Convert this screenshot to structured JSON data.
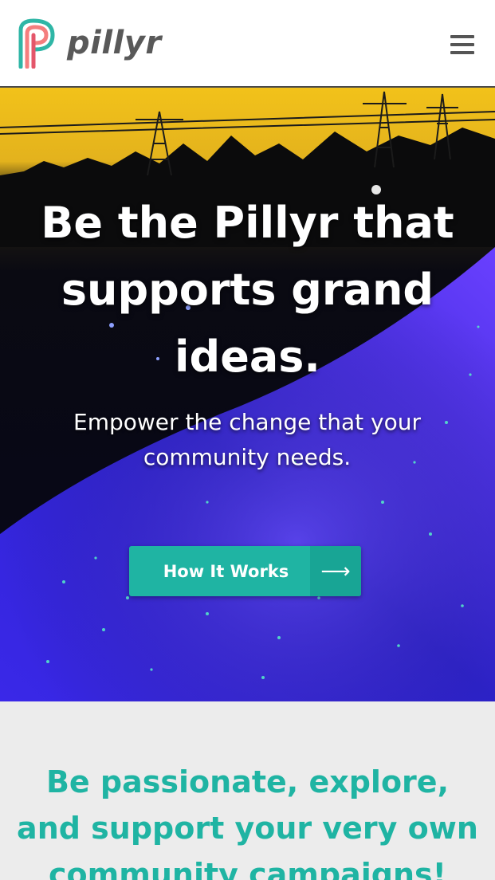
{
  "header": {
    "logo_text": "pillyr",
    "logo_icon": "pillyr-logo-mark",
    "menu_icon": "hamburger-menu-icon"
  },
  "hero": {
    "title": "Be the Pillyr that supports grand ideas.",
    "subtitle": "Empower the change that your community needs.",
    "cta_label": "How It Works",
    "cta_icon": "arrow-right-icon"
  },
  "section": {
    "heading": "Be passionate, explore, and support your very own community campaigns!"
  },
  "colors": {
    "accent": "#1fb4a3",
    "logo_gray": "#595959",
    "logo_coral": "#f06b6b",
    "background": "#ececec"
  }
}
